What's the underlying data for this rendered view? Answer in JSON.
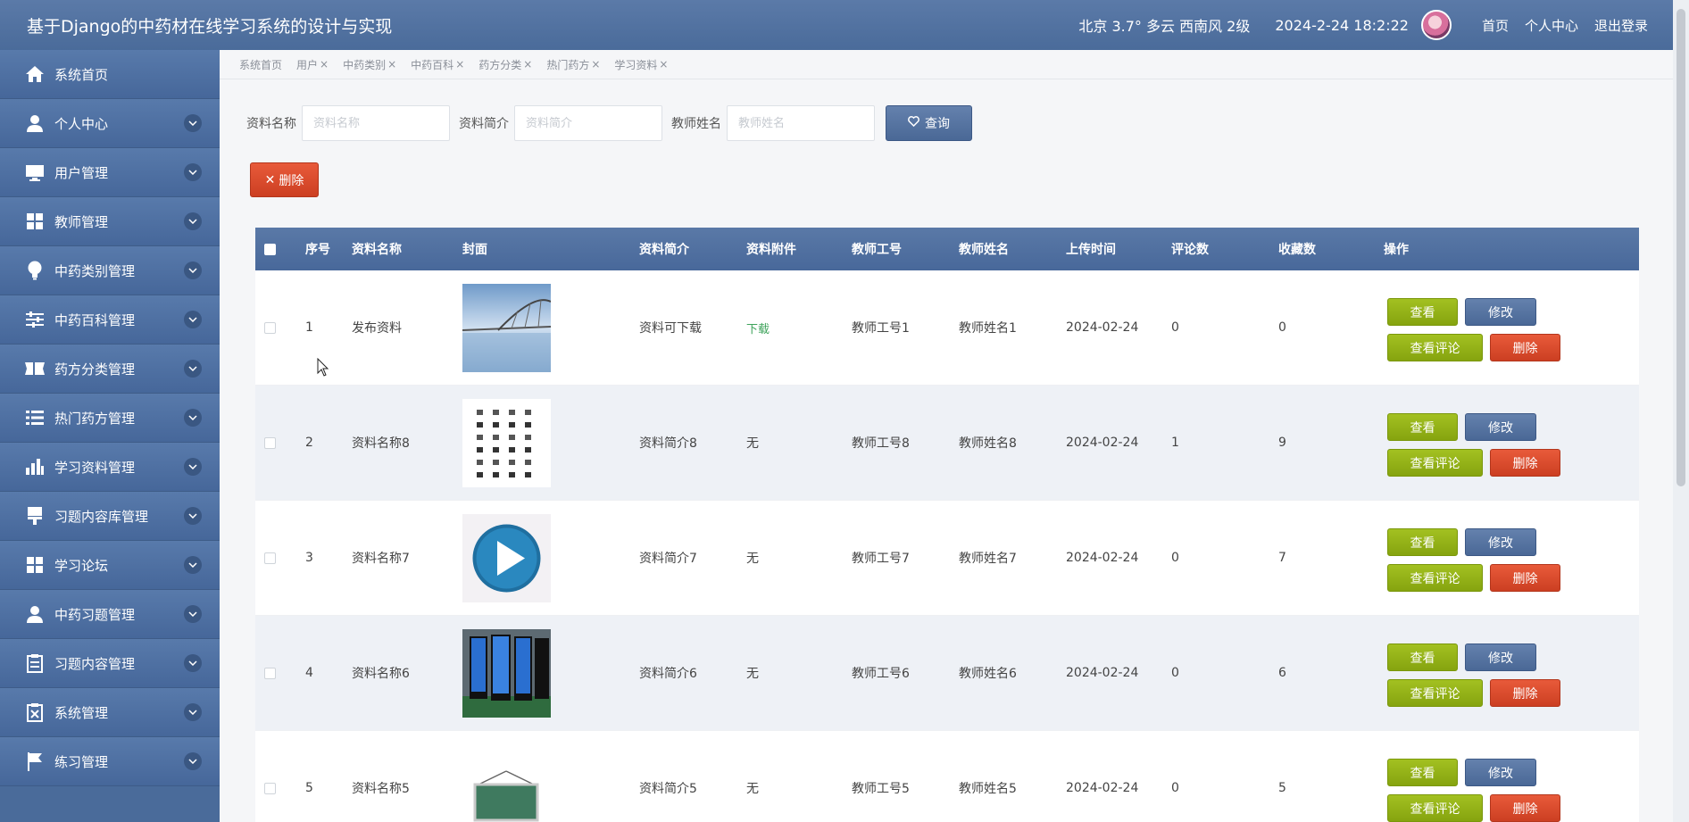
{
  "header": {
    "title": "基于Django的中药材在线学习系统的设计与实现",
    "weather": "北京  3.7°  多云  西南风  2级",
    "datetime": "2024-2-24 18:2:22",
    "links": [
      "首页",
      "个人中心",
      "退出登录"
    ]
  },
  "sidebar": {
    "items": [
      {
        "label": "系统首页",
        "icon": "home-icon"
      },
      {
        "label": "个人中心",
        "icon": "user-icon"
      },
      {
        "label": "用户管理",
        "icon": "monitor-icon"
      },
      {
        "label": "教师管理",
        "icon": "grid-icon"
      },
      {
        "label": "中药类别管理",
        "icon": "bulb-icon"
      },
      {
        "label": "中药百科管理",
        "icon": "sliders-icon"
      },
      {
        "label": "药方分类管理",
        "icon": "ticket-icon"
      },
      {
        "label": "热门药方管理",
        "icon": "list-icon"
      },
      {
        "label": "学习资料管理",
        "icon": "bar-chart-icon"
      },
      {
        "label": "习题内容库管理",
        "icon": "brush-icon"
      },
      {
        "label": "学习论坛",
        "icon": "grid-icon"
      },
      {
        "label": "中药习题管理",
        "icon": "user-icon"
      },
      {
        "label": "习题内容管理",
        "icon": "clipboard-icon"
      },
      {
        "label": "系统管理",
        "icon": "clipboard-x-icon"
      },
      {
        "label": "练习管理",
        "icon": "flag-icon"
      }
    ]
  },
  "tabs": [
    {
      "label": "系统首页",
      "closable": false
    },
    {
      "label": "用户",
      "closable": true
    },
    {
      "label": "中药类别",
      "closable": true
    },
    {
      "label": "中药百科",
      "closable": true
    },
    {
      "label": "药方分类",
      "closable": true
    },
    {
      "label": "热门药方",
      "closable": true
    },
    {
      "label": "学习资料",
      "closable": true
    }
  ],
  "tab_close_glyph": "×",
  "search": {
    "name_label": "资料名称",
    "name_placeholder": "资料名称",
    "intro_label": "资料简介",
    "intro_placeholder": "资料简介",
    "teacher_label": "教师姓名",
    "teacher_placeholder": "教师姓名",
    "query_label": "查询",
    "delete_label": "删除"
  },
  "table": {
    "columns": [
      "序号",
      "资料名称",
      "封面",
      "资料简介",
      "资料附件",
      "教师工号",
      "教师姓名",
      "上传时间",
      "评论数",
      "收藏数",
      "操作"
    ],
    "rows": [
      {
        "index": "1",
        "name": "发布资料",
        "cover": "bridge",
        "intro": "资料可下载",
        "attachment": "下载",
        "attachment_link": true,
        "teacher_id": "教师工号1",
        "teacher_name": "教师姓名1",
        "date": "2024-02-24",
        "comments": "0",
        "favorites": "0"
      },
      {
        "index": "2",
        "name": "资料名称8",
        "cover": "icons",
        "intro": "资料简介8",
        "attachment": "无",
        "attachment_link": false,
        "teacher_id": "教师工号8",
        "teacher_name": "教师姓名8",
        "date": "2024-02-24",
        "comments": "1",
        "favorites": "9"
      },
      {
        "index": "3",
        "name": "资料名称7",
        "cover": "play",
        "intro": "资料简介7",
        "attachment": "无",
        "attachment_link": false,
        "teacher_id": "教师工号7",
        "teacher_name": "教师姓名7",
        "date": "2024-02-24",
        "comments": "0",
        "favorites": "7"
      },
      {
        "index": "4",
        "name": "资料名称6",
        "cover": "kiosk",
        "intro": "资料简介6",
        "attachment": "无",
        "attachment_link": false,
        "teacher_id": "教师工号6",
        "teacher_name": "教师姓名6",
        "date": "2024-02-24",
        "comments": "0",
        "favorites": "6"
      },
      {
        "index": "5",
        "name": "资料名称5",
        "cover": "board",
        "intro": "资料简介5",
        "attachment": "无",
        "attachment_link": false,
        "teacher_id": "教师工号5",
        "teacher_name": "教师姓名5",
        "date": "2024-02-24",
        "comments": "0",
        "favorites": "5"
      }
    ],
    "actions": {
      "view": "查看",
      "edit": "修改",
      "comments": "查看评论",
      "delete": "删除"
    }
  },
  "colors": {
    "header": "#4a6b9a",
    "green_button": "#95b31a",
    "blue_button": "#587aa6",
    "red_button": "#d94a2c",
    "download_link": "#3ea35b"
  }
}
